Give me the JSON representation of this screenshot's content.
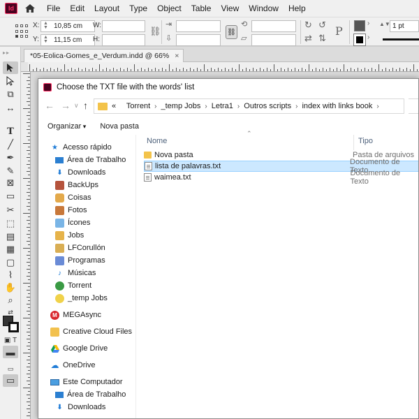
{
  "menubar": {
    "app_logo": "Id",
    "items": [
      "File",
      "Edit",
      "Layout",
      "Type",
      "Object",
      "Table",
      "View",
      "Window",
      "Help"
    ]
  },
  "control_panel": {
    "x_label": "X:",
    "x_value": "10,85 cm",
    "y_label": "Y:",
    "y_value": "11,15 cm",
    "w_label": "W:",
    "h_label": "H:",
    "stroke_weight": "1 pt"
  },
  "document_tab": {
    "title": "*05-Eolica-Gomes_e_Verdum.indd @ 66%",
    "close": "×"
  },
  "toolbox": {
    "tools": [
      "selection-tool",
      "direct-selection-tool",
      "page-tool",
      "gap-tool",
      "type-tool",
      "line-tool",
      "pen-tool",
      "pencil-tool",
      "rectangle-frame-tool",
      "rectangle-tool",
      "scissors-tool",
      "free-transform-tool",
      "gradient-swatch-tool",
      "gradient-feather-tool",
      "note-tool",
      "eyedropper-tool",
      "hand-tool",
      "zoom-tool"
    ]
  },
  "dialog": {
    "title": "Choose the TXT file with the words' list",
    "breadcrumb": [
      "Torrent",
      "_temp Jobs",
      "Letra1",
      "Outros scripts",
      "index with links book"
    ],
    "breadcrumb_prefix": "«",
    "organize": "Organizar",
    "new_folder": "Nova pasta",
    "columns": {
      "name": "Nome",
      "type": "Tipo"
    },
    "files": [
      {
        "name": "Nova pasta",
        "type": "Pasta de arquivos",
        "kind": "folder",
        "selected": false
      },
      {
        "name": "lista de palavras.txt",
        "type": "Documento de Texto",
        "kind": "txt",
        "selected": true
      },
      {
        "name": "waimea.txt",
        "type": "Documento de Texto",
        "kind": "txt",
        "selected": false
      }
    ],
    "nav": {
      "quick_access": "Acesso rápido",
      "quick_items": [
        "Área de Trabalho",
        "Downloads",
        "BackUps",
        "Coisas",
        "Fotos",
        "Ícones",
        "Jobs",
        "LFCorullón",
        "Programas",
        "Músicas",
        "Torrent",
        "_temp Jobs"
      ],
      "mega": "MEGAsync",
      "creative_cloud": "Creative Cloud Files",
      "google_drive": "Google Drive",
      "onedrive": "OneDrive",
      "this_pc": "Este Computador",
      "pc_items": [
        "Área de Trabalho",
        "Downloads"
      ]
    }
  },
  "colors": {
    "accent_selection": "#cce8ff",
    "folder": "#f3c34a",
    "indesign_brand": "#ff3366"
  }
}
